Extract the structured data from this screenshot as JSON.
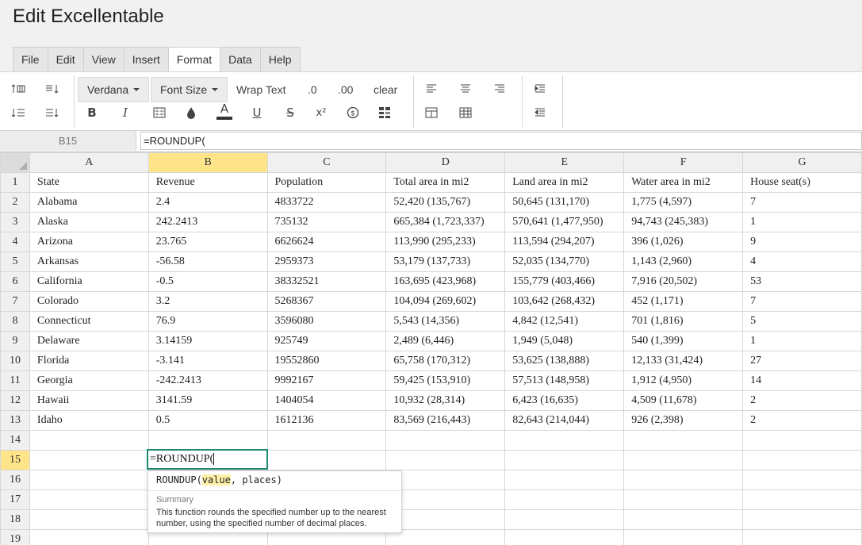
{
  "app": {
    "title": "Edit Excellentable"
  },
  "menu": {
    "items": [
      "File",
      "Edit",
      "View",
      "Insert",
      "Format",
      "Data",
      "Help"
    ],
    "active": "Format"
  },
  "toolbar": {
    "font_family": "Verdana",
    "font_size": "Font Size",
    "wrap_text": "Wrap Text",
    "decrease_decimals": ".0",
    "increase_decimals": ".00",
    "clear": "clear",
    "bold": "B",
    "italic": "I",
    "text_color": "A",
    "underline": "U",
    "strikethrough": "S",
    "superscript": "x²",
    "accent_color": "#1f8a70"
  },
  "formula_bar": {
    "cell_ref": "B15",
    "formula": "=ROUNDUP("
  },
  "sheet": {
    "columns": [
      "A",
      "B",
      "C",
      "D",
      "E",
      "F",
      "G"
    ],
    "selected_column": "B",
    "selected_row": "15",
    "rows": [
      {
        "num": "1",
        "cells": [
          "State",
          "Revenue",
          "Population",
          "Total area in mi2",
          "Land area in mi2",
          "Water area in mi2",
          "House seat(s)"
        ]
      },
      {
        "num": "2",
        "cells": [
          "Alabama",
          "2.4",
          "4833722",
          "52,420 (135,767)",
          "50,645 (131,170)",
          "1,775 (4,597)",
          "7"
        ]
      },
      {
        "num": "3",
        "cells": [
          "Alaska",
          "242.2413",
          "735132",
          "665,384 (1,723,337)",
          "570,641 (1,477,950)",
          "94,743 (245,383)",
          "1"
        ]
      },
      {
        "num": "4",
        "cells": [
          "Arizona",
          "23.765",
          "6626624",
          "113,990 (295,233)",
          "113,594 (294,207)",
          "396 (1,026)",
          "9"
        ]
      },
      {
        "num": "5",
        "cells": [
          "Arkansas",
          "-56.58",
          "2959373",
          "53,179 (137,733)",
          "52,035 (134,770)",
          "1,143 (2,960)",
          "4"
        ]
      },
      {
        "num": "6",
        "cells": [
          "California",
          "-0.5",
          "38332521",
          "163,695 (423,968)",
          "155,779 (403,466)",
          "7,916 (20,502)",
          "53"
        ]
      },
      {
        "num": "7",
        "cells": [
          "Colorado",
          "3.2",
          "5268367",
          "104,094 (269,602)",
          "103,642 (268,432)",
          "452 (1,171)",
          "7"
        ]
      },
      {
        "num": "8",
        "cells": [
          "Connecticut",
          "76.9",
          "3596080",
          "5,543 (14,356)",
          "4,842 (12,541)",
          "701 (1,816)",
          "5"
        ]
      },
      {
        "num": "9",
        "cells": [
          "Delaware",
          "3.14159",
          "925749",
          "2,489 (6,446)",
          "1,949 (5,048)",
          "540 (1,399)",
          "1"
        ]
      },
      {
        "num": "10",
        "cells": [
          "Florida",
          "-3.141",
          "19552860",
          "65,758 (170,312)",
          "53,625 (138,888)",
          "12,133 (31,424)",
          "27"
        ]
      },
      {
        "num": "11",
        "cells": [
          "Georgia",
          "-242.2413",
          "9992167",
          "59,425 (153,910)",
          "57,513 (148,958)",
          "1,912 (4,950)",
          "14"
        ]
      },
      {
        "num": "12",
        "cells": [
          "Hawaii",
          "3141.59",
          "1404054",
          "10,932 (28,314)",
          "6,423 (16,635)",
          "4,509 (11,678)",
          "2"
        ]
      },
      {
        "num": "13",
        "cells": [
          "Idaho",
          "0.5",
          "1612136",
          "83,569 (216,443)",
          "82,643 (214,044)",
          "926 (2,398)",
          "2"
        ]
      },
      {
        "num": "14",
        "cells": [
          "",
          "",
          "",
          "",
          "",
          "",
          ""
        ]
      },
      {
        "num": "15",
        "cells": [
          "",
          "",
          "",
          "",
          "",
          "",
          ""
        ]
      },
      {
        "num": "16",
        "cells": [
          "",
          "",
          "",
          "",
          "",
          "",
          ""
        ]
      },
      {
        "num": "17",
        "cells": [
          "",
          "",
          "",
          "",
          "",
          "",
          ""
        ]
      },
      {
        "num": "18",
        "cells": [
          "",
          "",
          "",
          "",
          "",
          "",
          ""
        ]
      },
      {
        "num": "19",
        "cells": [
          "",
          "",
          "",
          "",
          "",
          "",
          ""
        ]
      }
    ]
  },
  "editor": {
    "value": "=ROUNDUP("
  },
  "tooltip": {
    "fn": "ROUNDUP(",
    "param_active": "value",
    "params_rest": ", places)",
    "summary_label": "Summary",
    "summary": "This function rounds the specified number up to the nearest number, using the specified number of decimal places."
  }
}
